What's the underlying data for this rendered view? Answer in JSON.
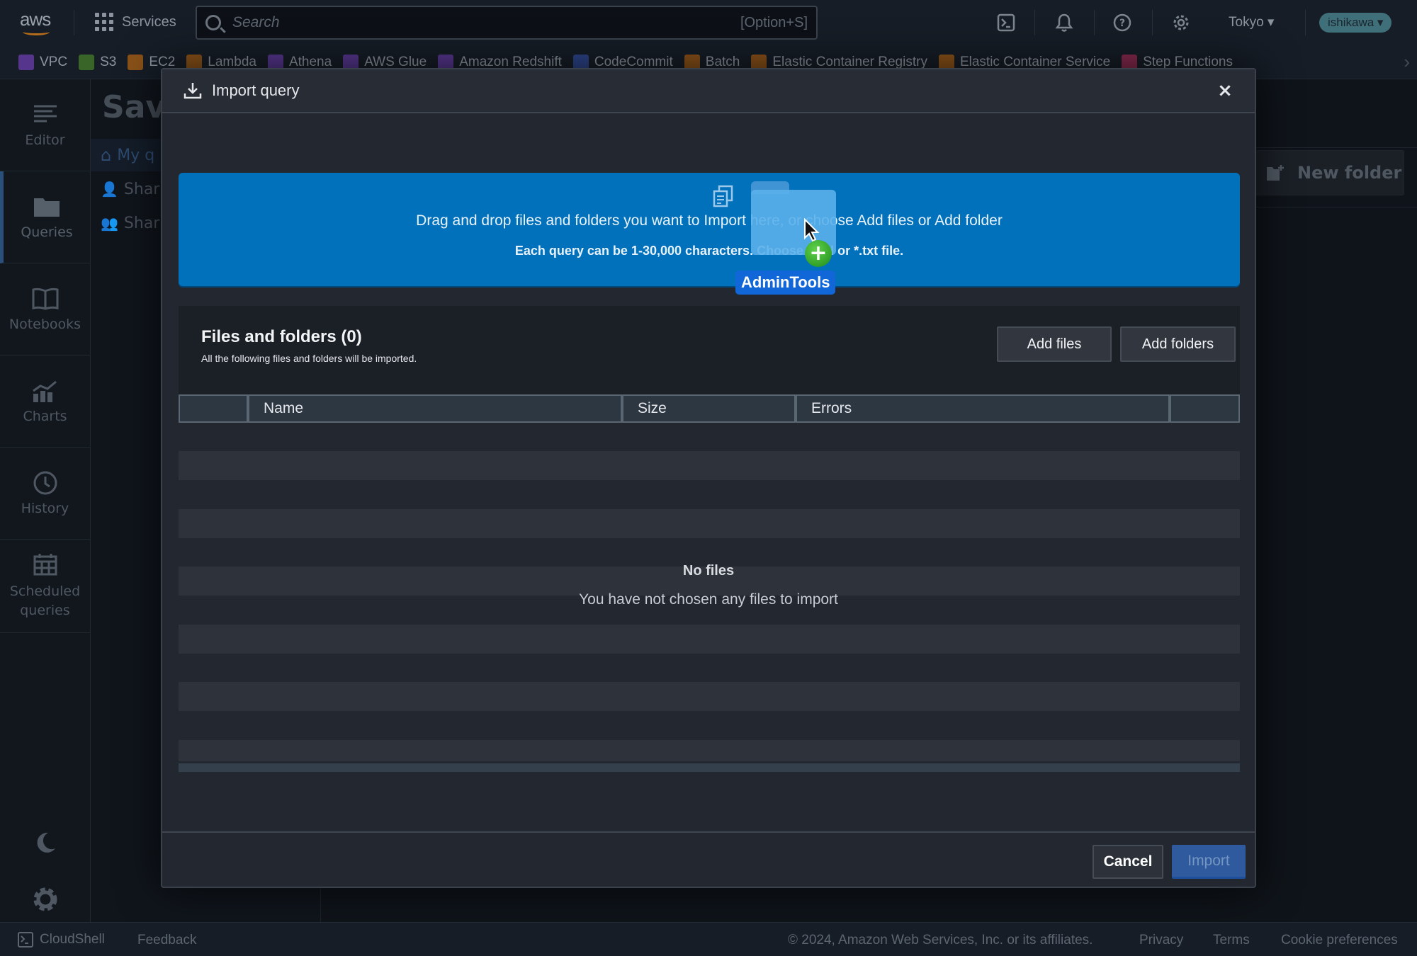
{
  "topnav": {
    "logo": "aws",
    "services_label": "Services",
    "search_placeholder": "Search",
    "search_shortcut": "[Option+S]",
    "region": "Tokyo ▾",
    "user": "ishikawa ▾",
    "icons": [
      "cloudshell-icon",
      "bell-icon",
      "help-icon",
      "settings-icon"
    ]
  },
  "favorites": [
    {
      "label": "VPC",
      "color": "#8a4be0"
    },
    {
      "label": "S3",
      "color": "#5aa02c"
    },
    {
      "label": "EC2",
      "color": "#ea7b0c"
    },
    {
      "label": "Lambda",
      "color": "#ea7b0c"
    },
    {
      "label": "Athena",
      "color": "#8a4be0"
    },
    {
      "label": "AWS Glue",
      "color": "#8a4be0"
    },
    {
      "label": "Amazon Redshift",
      "color": "#8a4be0"
    },
    {
      "label": "CodeCommit",
      "color": "#3f63d8"
    },
    {
      "label": "Batch",
      "color": "#ea7b0c"
    },
    {
      "label": "Elastic Container Registry",
      "color": "#ea7b0c"
    },
    {
      "label": "Elastic Container Service",
      "color": "#ea7b0c"
    },
    {
      "label": "Step Functions",
      "color": "#e0336b"
    }
  ],
  "rail": {
    "items": [
      {
        "label": "Editor",
        "icon": "editor-icon"
      },
      {
        "label": "Queries",
        "icon": "folder-icon",
        "active": true
      },
      {
        "label": "Notebooks",
        "icon": "book-icon"
      },
      {
        "label": "Charts",
        "icon": "chart-icon"
      },
      {
        "label": "History",
        "icon": "clock-icon"
      },
      {
        "label": "Scheduled\nqueries",
        "icon": "calendar-icon"
      }
    ]
  },
  "panel2": {
    "title": "Save",
    "items": [
      "My q",
      "Shar",
      "Shar"
    ]
  },
  "main": {
    "new_folder_label": "New folder"
  },
  "modal": {
    "title": "Import query",
    "close_label": "×",
    "dropzone": {
      "line1": "Drag and drop files and folders you want to Import here, or choose Add files or Add folder",
      "line2": "Each query can be 1-30,000 characters. Choose *.sql or *.txt file."
    },
    "drag_item": {
      "label": "AdminTools",
      "badge": "+"
    },
    "files": {
      "title": "Files and folders (0)",
      "subtitle": "All the following files and folders will be imported.",
      "add_files_label": "Add files",
      "add_folders_label": "Add folders"
    },
    "table": {
      "columns": [
        "",
        "Name",
        "Size",
        "Errors",
        ""
      ],
      "rows": [],
      "empty_title": "No files",
      "empty_message": "You have not chosen any files to import"
    },
    "cancel_label": "Cancel",
    "import_label": "Import"
  },
  "footer": {
    "cloudshell": "CloudShell",
    "feedback": "Feedback",
    "copyright": "© 2024, Amazon Web Services, Inc. or its affiliates.",
    "privacy": "Privacy",
    "terms": "Terms",
    "cookies": "Cookie preferences"
  }
}
